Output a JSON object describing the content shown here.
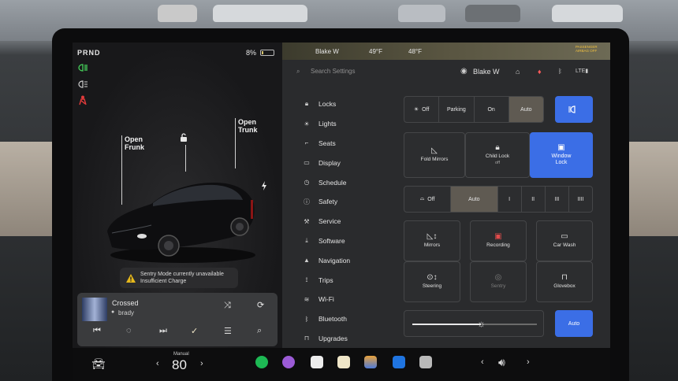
{
  "status": {
    "gear": "PRND",
    "battery": "8%",
    "battery_fill": 0.08
  },
  "left": {
    "callouts": {
      "frunk": "Open\nFrunk",
      "trunk": "Open\nTrunk"
    },
    "warning": {
      "line1": "Sentry Mode currently unavailable",
      "line2": "Insufficient Charge"
    },
    "media": {
      "title": "Crossed",
      "artist": "brady"
    }
  },
  "topbar": {
    "name": "Blake W",
    "temp_left": "49°F",
    "temp_right": "48°F",
    "airbag": "PASSENGER AIRBAG OFF"
  },
  "search": {
    "placeholder": "Search Settings"
  },
  "user": {
    "name": "Blake W"
  },
  "menu": [
    {
      "label": "Locks",
      "icon": "lock-icon"
    },
    {
      "label": "Lights",
      "icon": "sun-icon"
    },
    {
      "label": "Seats",
      "icon": "seat-icon"
    },
    {
      "label": "Display",
      "icon": "display-icon"
    },
    {
      "label": "Schedule",
      "icon": "clock-icon"
    },
    {
      "label": "Safety",
      "icon": "info-icon"
    },
    {
      "label": "Service",
      "icon": "wrench-icon"
    },
    {
      "label": "Software",
      "icon": "download-icon"
    },
    {
      "label": "Navigation",
      "icon": "nav-icon"
    },
    {
      "label": "Trips",
      "icon": "trips-icon"
    },
    {
      "label": "Wi-Fi",
      "icon": "wifi-icon"
    },
    {
      "label": "Bluetooth",
      "icon": "bluetooth-icon"
    },
    {
      "label": "Upgrades",
      "icon": "bag-icon"
    }
  ],
  "lights": {
    "off": "Off",
    "parking": "Parking",
    "on": "On",
    "auto": "Auto"
  },
  "locks": {
    "fold": "Fold Mirrors",
    "child": "Child Lock",
    "child_state": "off",
    "window": "Window\nLock"
  },
  "wipers": {
    "off": "Off",
    "auto": "Auto",
    "i": "I",
    "ii": "II",
    "iii": "III",
    "iiii": "IIII"
  },
  "tiles": {
    "mirrors": "Mirrors",
    "recording": "Recording",
    "carwash": "Car Wash",
    "steering": "Steering",
    "sentry": "Sentry",
    "glovebox": "Glovebox"
  },
  "brightness": {
    "auto": "Auto",
    "level": 0.55
  },
  "dock": {
    "climate_mode": "Manual",
    "temp": "80"
  },
  "colors": {
    "accent": "#3b6ee6",
    "selected": "#5f5a52"
  }
}
